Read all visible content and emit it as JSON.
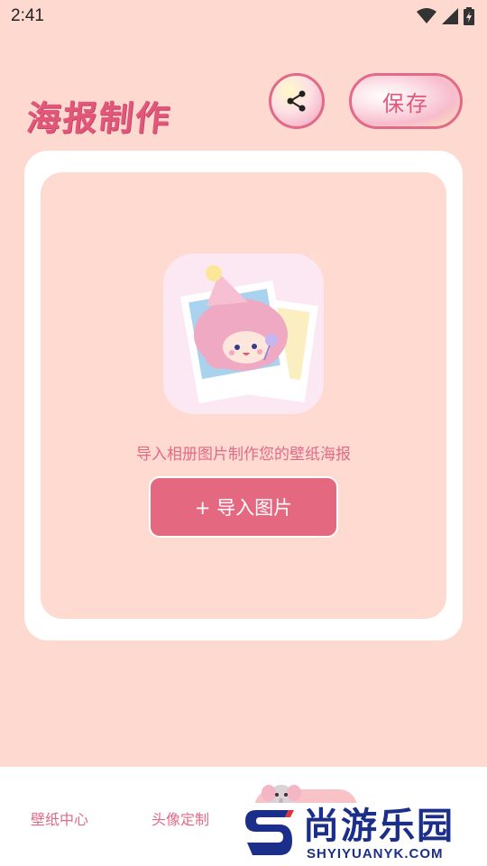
{
  "status_bar": {
    "time": "2:41",
    "icons": [
      "wifi-icon",
      "signal-icon",
      "battery-icon"
    ]
  },
  "header": {
    "title": "海报制作",
    "save_label": "保存",
    "share_icon": "share-icon"
  },
  "main": {
    "hint": "导入相册图片制作您的壁纸海报",
    "import_label": "+ 导入图片"
  },
  "bottom_nav": {
    "items": [
      {
        "label": "壁纸中心"
      },
      {
        "label": "头像定制"
      }
    ]
  },
  "watermark": {
    "cn": "尚游乐园",
    "en": "SHYIYUANYK.COM"
  },
  "colors": {
    "background": "#fdd9d0",
    "accent": "#e0577a",
    "button": "#e4687f",
    "watermark": "#1b2f8a"
  }
}
